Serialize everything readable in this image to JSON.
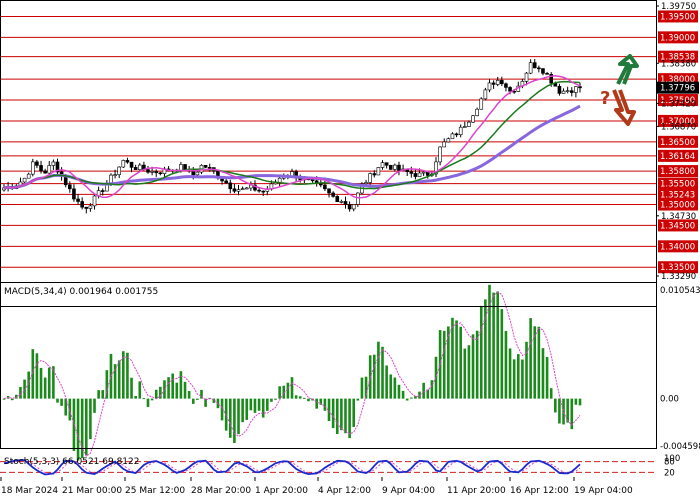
{
  "chart_data": {
    "type": "candlestick",
    "symbol_label": "USDCAD,H4",
    "price_panel": {
      "ylim": [
        1.3329,
        1.3975
      ],
      "tick_labels": [
        {
          "value": 1.3975,
          "text": "1.39750"
        },
        {
          "value": 1.3838,
          "text": "1.38380"
        },
        {
          "value": 1.3742,
          "text": "1.37420"
        },
        {
          "value": 1.3687,
          "text": "1.36870"
        },
        {
          "value": 1.3473,
          "text": "1.34730"
        },
        {
          "value": 1.3329,
          "text": "1.33290"
        }
      ],
      "levels": [
        {
          "value": 1.395,
          "text": "1.39500"
        },
        {
          "value": 1.39,
          "text": "1.39000"
        },
        {
          "value": 1.38538,
          "text": "1.38538"
        },
        {
          "value": 1.38,
          "text": "1.38000"
        },
        {
          "value": 1.375,
          "text": "1.37500"
        },
        {
          "value": 1.37,
          "text": "1.37000"
        },
        {
          "value": 1.365,
          "text": "1.36500"
        },
        {
          "value": 1.36164,
          "text": "1.36164"
        },
        {
          "value": 1.358,
          "text": "1.35800"
        },
        {
          "value": 1.355,
          "text": "1.35500"
        },
        {
          "value": 1.35243,
          "text": "1.35243"
        },
        {
          "value": 1.35,
          "text": "1.35000"
        },
        {
          "value": 1.345,
          "text": "1.34500"
        },
        {
          "value": 1.34,
          "text": "1.34000"
        },
        {
          "value": 1.335,
          "text": "1.33500"
        }
      ],
      "current_price": {
        "value": 1.37796,
        "text": "1.37796"
      },
      "close_path": [
        1.354,
        1.3545,
        1.356,
        1.36,
        1.3575,
        1.36,
        1.356,
        1.352,
        1.349,
        1.351,
        1.354,
        1.357,
        1.3605,
        1.359,
        1.3585,
        1.3578,
        1.358,
        1.3585,
        1.359,
        1.357,
        1.3595,
        1.358,
        1.356,
        1.354,
        1.3535,
        1.354,
        1.353,
        1.3545,
        1.357,
        1.3575,
        1.356,
        1.355,
        1.354,
        1.352,
        1.351,
        1.349,
        1.3545,
        1.357,
        1.36,
        1.359,
        1.358,
        1.3575,
        1.357,
        1.3575,
        1.364,
        1.366,
        1.368,
        1.371,
        1.375,
        1.379,
        1.38,
        1.377,
        1.379,
        1.3835,
        1.383,
        1.38,
        1.377,
        1.3775,
        1.378
      ],
      "bar_width": 3,
      "bar_count": 141,
      "ma_series": [
        {
          "name": "",
          "color": "#8866dd",
          "period": 40
        },
        {
          "name": "",
          "color": "#1a7a1a",
          "period": 20
        },
        {
          "name": "",
          "color": "#dd44cc",
          "period": 10
        }
      ],
      "annotations": {
        "up_arrow_color": "#1f7a3c",
        "down_arrow_color": "#b03a1a",
        "question_mark": "?",
        "question_color": "#b03a1a"
      }
    },
    "macd_panel": {
      "label": "MACD(5,34,4) 0.001964 0.001755",
      "ylim": [
        -0.004598,
        0.010543
      ],
      "tick_labels": [
        {
          "value": 0.010543,
          "text": "0.010543"
        },
        {
          "value": 0.0,
          "text": "0.00"
        },
        {
          "value": -0.004598,
          "text": "-0.004598"
        }
      ],
      "bar_color": "#1a8a1a",
      "signal_color": "#dd44cc"
    },
    "stoch_panel": {
      "label": "Stoch(5,3,3) 66.0521 69.8122",
      "ylim": [
        0,
        100
      ],
      "tick_labels": [
        {
          "value": 100,
          "text": "100"
        },
        {
          "value": 80,
          "text": "80"
        },
        {
          "value": 20,
          "text": "20"
        },
        {
          "value": 0,
          "text": "0"
        }
      ],
      "levels": [
        80,
        20
      ],
      "level_color": "#cc2222",
      "main_color": "#1a2acc",
      "signal_color": "#dd44cc",
      "main_path": [
        70,
        85,
        90,
        40,
        8,
        15,
        85,
        80,
        20,
        10,
        50,
        80,
        30,
        15,
        70,
        85,
        60,
        15,
        35,
        80,
        85,
        20,
        25,
        80,
        55,
        15,
        40,
        75,
        85,
        35,
        10,
        15,
        55,
        85,
        80,
        25,
        15,
        80,
        85,
        20,
        25,
        85,
        80,
        15,
        80,
        85,
        50,
        20,
        80,
        85,
        25,
        20,
        80,
        85,
        60,
        15,
        15,
        65
      ]
    },
    "x_axis": {
      "tick_labels": [
        "18 Mar 2024",
        "21 Mar 00:00",
        "25 Mar 12:00",
        "28 Mar 20:00",
        "1 Apr 20:00",
        "4 Apr 12:00",
        "9 Apr 04:00",
        "11 Apr 20:00",
        "16 Apr 12:00",
        "19 Apr 04:00"
      ]
    },
    "colors": {
      "level_line": "#cc0000",
      "label_bg": "#cc0000",
      "current_bg": "#000000",
      "bull": "#ffffff",
      "bear": "#000000",
      "panel_border": "#000000"
    }
  }
}
